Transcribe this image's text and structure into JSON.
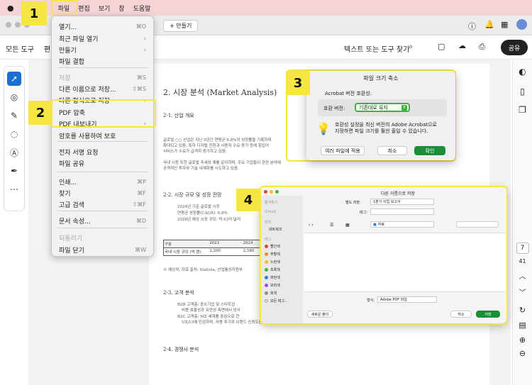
{
  "menubar": {
    "items": [
      "파일",
      "편집",
      "보기",
      "창",
      "도움말"
    ]
  },
  "tabbar": {
    "new_tab": "+ 만들기"
  },
  "toolbar": {
    "all_tools": "모든 도구",
    "edit_cut": "편",
    "search": "텍스트 또는 도구 찾기",
    "share": "공유"
  },
  "file_menu": {
    "items": [
      {
        "label": "열기...",
        "shortcut": "⌘O",
        "disabled": false
      },
      {
        "label": "최근 파일 열기",
        "shortcut": "›",
        "disabled": false
      },
      {
        "label": "만들기",
        "shortcut": "›",
        "disabled": false
      },
      {
        "label": "파일 결합",
        "shortcut": "",
        "disabled": false
      },
      {
        "label": "저장",
        "shortcut": "⌘S",
        "disabled": true
      },
      {
        "label": "다른 이름으로 저장...",
        "shortcut": "⇧⌘S",
        "disabled": false
      },
      {
        "label": "다른 형식으로 저장",
        "shortcut": "›",
        "disabled": false
      },
      {
        "label": "PDF 압축",
        "shortcut": "",
        "disabled": false
      },
      {
        "label": "PDF 내보내기",
        "shortcut": "›",
        "disabled": false
      },
      {
        "label": "암호를 사용하여 보호",
        "shortcut": "",
        "disabled": false
      },
      {
        "label": "전자 서명 요청",
        "shortcut": "",
        "disabled": false
      },
      {
        "label": "파일 공유",
        "shortcut": "",
        "disabled": false
      },
      {
        "label": "인쇄...",
        "shortcut": "⌘P",
        "disabled": false
      },
      {
        "label": "찾기",
        "shortcut": "⌘F",
        "disabled": false
      },
      {
        "label": "고급 검색",
        "shortcut": "⇧⌘F",
        "disabled": false
      },
      {
        "label": "문서 속성...",
        "shortcut": "⌘D",
        "disabled": false
      },
      {
        "label": "되돌리기",
        "shortcut": "",
        "disabled": true
      },
      {
        "label": "파일 닫기",
        "shortcut": "⌘W",
        "disabled": false
      }
    ]
  },
  "badges": [
    "1",
    "2",
    "3",
    "4"
  ],
  "document": {
    "heading": "2. 시장 분석 (Market Analysis)",
    "s1": "2-1. 산업 개요",
    "p1": "글로벌 ○○ 산업은 지난 5년간 연평균 6.8%의 성장률을 기록하며",
    "p1b": "확대되고 있음. 특히 디지털 전환과 사용자 수요 증가 등에 힘입어",
    "p1c": "서비스가 수요가 급격히 증가하고 있음.",
    "p2": "국내 시장 또한 글로벌 추세와 궤를 같이하며, 주요 기업들이 관련 분야에",
    "p2b": "공격적인 투자와 기술 내재화를 시도하고 있음.",
    "s2": "2-2. 시장 규모 및 성장 전망",
    "b1": "2024년 기준 글로벌 시장",
    "b2": "연평균 성장률(CAGR): 6.8%",
    "b3": "2028년 예상 시장 규모: 약 63억 달러",
    "table_head": [
      "구분",
      "2023",
      "2024"
    ],
    "table_row": [
      "국내 시장 규모 (억 원)",
      "2,200",
      "2,580"
    ],
    "note": "※ 예상치, 자료 출처: Statista, 산업통상자원부",
    "s3": "2-3. 고객 분석",
    "c1": "B2B 고객층: 중소기업 및 스타트업",
    "c1b": "비용 효율성과 유연성 측면에서 당사",
    "c2": "B2C 고객층: MZ 세대를 중심으로 한",
    "c2b": "UX/UI에 민감하며, 사용 후기와 브랜드 신뢰도를 중요시 여김.",
    "s4": "2-4. 경쟁사 분석"
  },
  "compress_dialog": {
    "title": "파일 크기 축소",
    "compat_label": "Acrobat 버전 호환성:",
    "version_label": "호환 버전:",
    "version_value": "기존대로 유지",
    "info": "호환성 설정을 최신 버전의 Adobe Acrobat으로 지정하면 파일 크기를 훨씬 줄일 수 있습니다.",
    "apply_multi": "여러 파일에 적용",
    "cancel": "취소",
    "ok": "확인"
  },
  "save_dialog": {
    "title": "다른 이름으로 저장",
    "name_label": "별도 저장:",
    "name_value": "1분기 사업 보고서",
    "tags_label": "태그:",
    "location": "자료",
    "sidebar_sections": [
      "즐겨찾기",
      "iCloud",
      "위치",
      "태그"
    ],
    "sidebar_items": [
      "네트워크"
    ],
    "tags": [
      {
        "name": "빨간색",
        "color": "#e0443e"
      },
      {
        "name": "주황색",
        "color": "#f08a24"
      },
      {
        "name": "노란색",
        "color": "#f5c400"
      },
      {
        "name": "초록색",
        "color": "#3bb54a"
      },
      {
        "name": "파란색",
        "color": "#2f7de1"
      },
      {
        "name": "보라색",
        "color": "#9a4fd6"
      },
      {
        "name": "회색",
        "color": "#8e8e93"
      },
      {
        "name": "모든 태그...",
        "color": ""
      }
    ],
    "format_label": "형식:",
    "format_value": "Adobe PDF 파일",
    "new_folder": "새로운 폴더",
    "cancel": "취소",
    "save": "저장"
  },
  "page_indicator": {
    "current": "7",
    "total": "41"
  },
  "colors": {
    "accent": "#1a8f3a",
    "badge": "#f5e642",
    "menubar": "#f5d4d6"
  }
}
